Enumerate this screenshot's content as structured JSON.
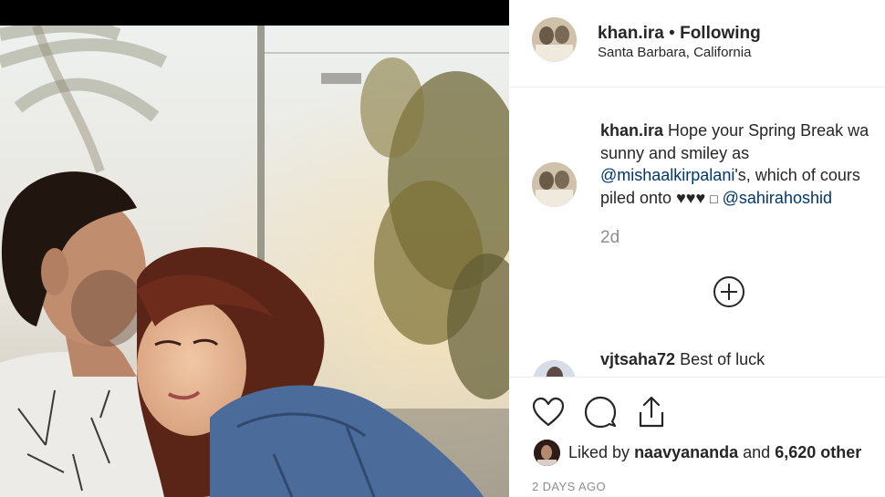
{
  "post": {
    "username": "khan.ira",
    "separator": "•",
    "follow_status": "Following",
    "location": "Santa Barbara, California"
  },
  "caption": {
    "username": "khan.ira",
    "line1_text": "Hope your Spring Break wa",
    "line2_text": "sunny and smiley as",
    "line3_mention": "@mishaalkirpalani",
    "line3_text": "'s, which of cours",
    "line4_text": "piled onto ♥♥♥",
    "line4_glyph": "□",
    "line4_mention": "@sahirahoshid",
    "time": "2d"
  },
  "load_more": {
    "icon": "plus-circle-icon"
  },
  "comments": [
    {
      "username": "vjtsaha72",
      "text": "Best of luck"
    }
  ],
  "actions": {
    "like_icon": "heart-icon",
    "comment_icon": "speech-bubble-icon",
    "share_icon": "share-icon"
  },
  "likes": {
    "prefix": "Liked by",
    "user": "naavyananda",
    "joiner": "and",
    "count": "6,620 other"
  },
  "timestamp": "2 DAYS AGO",
  "colors": {
    "text": "#262626",
    "secondary": "#8e8e8e",
    "mention": "#00376b",
    "divider": "#efefef",
    "photo_top_bar": "#000000"
  }
}
